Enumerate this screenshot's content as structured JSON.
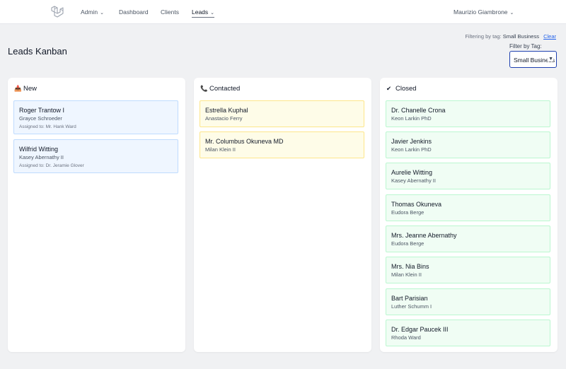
{
  "nav": {
    "logo_icon": "laravel-logo-icon",
    "items": [
      {
        "label": "Admin",
        "has_dropdown": true
      },
      {
        "label": "Dashboard",
        "has_dropdown": false
      },
      {
        "label": "Clients",
        "has_dropdown": false
      },
      {
        "label": "Leads",
        "has_dropdown": true,
        "active": true
      }
    ],
    "user": {
      "name": "Maurizio Giambrone",
      "has_dropdown": true
    }
  },
  "header": {
    "title": "Leads Kanban",
    "filter_status": {
      "prefix": "Filtering by tag:",
      "tag": "Small Business",
      "clear_label": "Clear"
    },
    "filter_label": "Filter by Tag:",
    "filter_value": "Small Business"
  },
  "columns": [
    {
      "title": "New",
      "icon": "inbox-tray-icon",
      "cards": [
        {
          "name": "Roger Trantow I",
          "company": "Grayce Schroeder",
          "assigned": "Assigned to: Mr. Hank Ward"
        },
        {
          "name": "Wilfrid Witting",
          "company": "Kasey Abernathy II",
          "assigned": "Assigned to: Dr. Jeramie Glover"
        }
      ]
    },
    {
      "title": "Contacted",
      "icon": "telephone-icon",
      "cards": [
        {
          "name": "Estrella Kuphal",
          "company": "Anastacio Ferry"
        },
        {
          "name": "Mr. Columbus Okuneva MD",
          "company": "Milan Klein II"
        }
      ]
    },
    {
      "title": "Closed",
      "icon": "check-mark-icon",
      "cards": [
        {
          "name": "Dr. Chanelle Crona",
          "company": "Keon Larkin PhD"
        },
        {
          "name": "Javier Jenkins",
          "company": "Keon Larkin PhD"
        },
        {
          "name": "Aurelie Witting",
          "company": "Kasey Abernathy II"
        },
        {
          "name": "Thomas Okuneva",
          "company": "Eudora Berge"
        },
        {
          "name": "Mrs. Jeanne Abernathy",
          "company": "Eudora Berge"
        },
        {
          "name": "Mrs. Nia Bins",
          "company": "Milan Klein II"
        },
        {
          "name": "Bart Parisian",
          "company": "Luther Schumm I"
        },
        {
          "name": "Dr. Edgar Paucek III",
          "company": "Rhoda Ward"
        }
      ]
    }
  ],
  "colors": {
    "new": "#eff6ff",
    "contacted": "#fefce8",
    "closed": "#f0fdf4",
    "accent": "#2563eb"
  }
}
